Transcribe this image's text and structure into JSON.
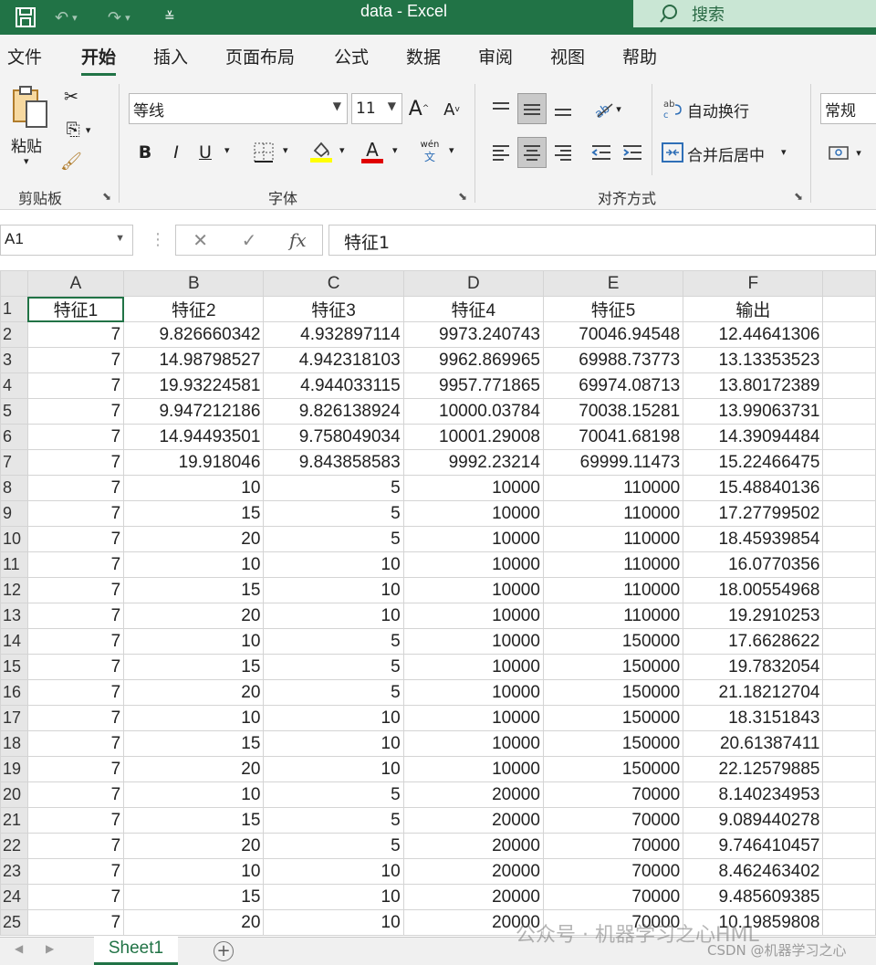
{
  "window": {
    "title": "data  -  Excel",
    "search_placeholder": "搜索"
  },
  "menu": {
    "tabs": [
      "文件",
      "开始",
      "插入",
      "页面布局",
      "公式",
      "数据",
      "审阅",
      "视图",
      "帮助"
    ],
    "active": "开始"
  },
  "ribbon": {
    "clipboard": {
      "paste_label": "粘贴",
      "group_label": "剪贴板"
    },
    "font": {
      "font_name": "等线",
      "font_size": "11",
      "group_label": "字体",
      "bold": "B",
      "italic": "I",
      "underline": "U",
      "grow": "A",
      "shrink": "A",
      "font_color_letter": "A",
      "phonetic_top": "wén",
      "phonetic_bottom": "文"
    },
    "alignment": {
      "wrap_text": "自动换行",
      "merge_center": "合并后居中",
      "group_label": "对齐方式"
    },
    "number": {
      "format": "常规"
    },
    "colors": {
      "highlight": "#ffff00",
      "font_color": "#e00000",
      "accent": "#217346"
    }
  },
  "formula_bar": {
    "name_box": "A1",
    "cancel": "✕",
    "enter": "✓",
    "fx": "fx",
    "content": "特征1"
  },
  "sheet": {
    "columns": [
      "A",
      "B",
      "C",
      "D",
      "E",
      "F"
    ],
    "rows": [
      [
        "特征1",
        "特征2",
        "特征3",
        "特征4",
        "特征5",
        "输出"
      ],
      [
        "7",
        "9.826660342",
        "4.932897114",
        "9973.240743",
        "70046.94548",
        "12.44641306"
      ],
      [
        "7",
        "14.98798527",
        "4.942318103",
        "9962.869965",
        "69988.73773",
        "13.13353523"
      ],
      [
        "7",
        "19.93224581",
        "4.944033115",
        "9957.771865",
        "69974.08713",
        "13.80172389"
      ],
      [
        "7",
        "9.947212186",
        "9.826138924",
        "10000.03784",
        "70038.15281",
        "13.99063731"
      ],
      [
        "7",
        "14.94493501",
        "9.758049034",
        "10001.29008",
        "70041.68198",
        "14.39094484"
      ],
      [
        "7",
        "19.918046",
        "9.843858583",
        "9992.23214",
        "69999.11473",
        "15.22466475"
      ],
      [
        "7",
        "10",
        "5",
        "10000",
        "110000",
        "15.48840136"
      ],
      [
        "7",
        "15",
        "5",
        "10000",
        "110000",
        "17.27799502"
      ],
      [
        "7",
        "20",
        "5",
        "10000",
        "110000",
        "18.45939854"
      ],
      [
        "7",
        "10",
        "10",
        "10000",
        "110000",
        "16.0770356"
      ],
      [
        "7",
        "15",
        "10",
        "10000",
        "110000",
        "18.00554968"
      ],
      [
        "7",
        "20",
        "10",
        "10000",
        "110000",
        "19.2910253"
      ],
      [
        "7",
        "10",
        "5",
        "10000",
        "150000",
        "17.6628622"
      ],
      [
        "7",
        "15",
        "5",
        "10000",
        "150000",
        "19.7832054"
      ],
      [
        "7",
        "20",
        "5",
        "10000",
        "150000",
        "21.18212704"
      ],
      [
        "7",
        "10",
        "10",
        "10000",
        "150000",
        "18.3151843"
      ],
      [
        "7",
        "15",
        "10",
        "10000",
        "150000",
        "20.61387411"
      ],
      [
        "7",
        "20",
        "10",
        "10000",
        "150000",
        "22.12579885"
      ],
      [
        "7",
        "10",
        "5",
        "20000",
        "70000",
        "8.140234953"
      ],
      [
        "7",
        "15",
        "5",
        "20000",
        "70000",
        "9.089440278"
      ],
      [
        "7",
        "20",
        "5",
        "20000",
        "70000",
        "9.746410457"
      ],
      [
        "7",
        "10",
        "10",
        "20000",
        "70000",
        "8.462463402"
      ],
      [
        "7",
        "15",
        "10",
        "20000",
        "70000",
        "9.485609385"
      ],
      [
        "7",
        "20",
        "10",
        "20000",
        "70000",
        "10.19859808"
      ]
    ],
    "tab_name": "Sheet1",
    "add_sheet": "+"
  },
  "watermark": {
    "line1": "公众号 · 机器学习之心HML",
    "line2": "CSDN @机器学习之心"
  }
}
